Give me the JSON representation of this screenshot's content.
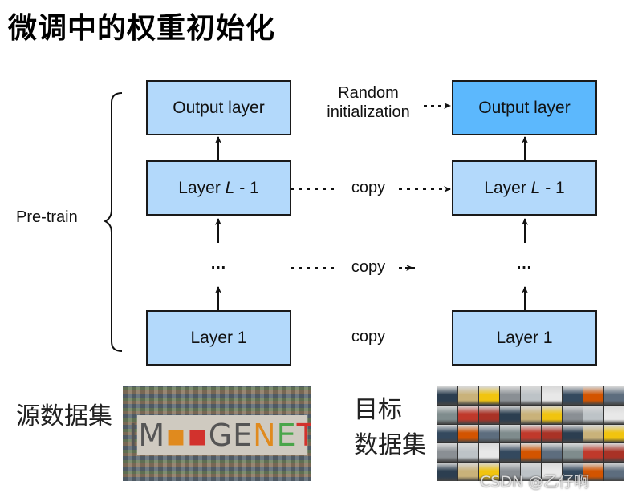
{
  "title": "微调中的权重初始化",
  "brace_label": "Pre-train",
  "left_column": {
    "output_layer": "Output layer",
    "layer_l_minus_1": {
      "prefix": "Layer ",
      "var": "L",
      "suffix": " - 1"
    },
    "ellipsis": "…",
    "layer_1": "Layer 1"
  },
  "right_column": {
    "output_layer": "Output layer",
    "layer_l_minus_1": {
      "prefix": "Layer ",
      "var": "L",
      "suffix": " - 1"
    },
    "ellipsis": "…",
    "layer_1": "Layer 1"
  },
  "connectors": {
    "random_init_line1": "Random",
    "random_init_line2": "initialization",
    "copy_top": "copy",
    "copy_middle": "copy",
    "copy_bottom": "copy"
  },
  "colors": {
    "box_fill": "#b3d9fb",
    "highlight_fill": "#5cb8fd",
    "border": "#1a1a1a"
  },
  "datasets": {
    "source_label": "源数据集",
    "source_image_text": [
      "IM",
      "A",
      "GE",
      "N",
      "E",
      "T"
    ],
    "target_label_line1": "目标",
    "target_label_line2": "数据集"
  },
  "watermark": "CSDN @乙仔啊"
}
